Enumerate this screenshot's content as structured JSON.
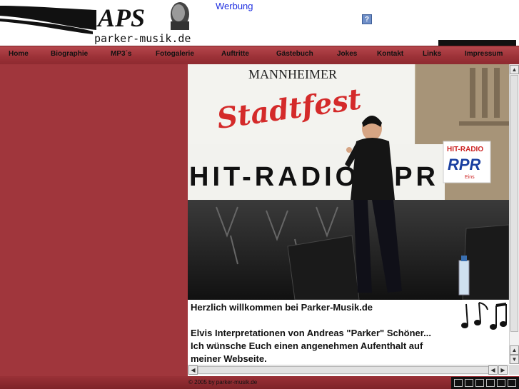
{
  "header": {
    "logo_text": "APS",
    "logo_domain": "parker-musik.de",
    "ad_link": "Werbung",
    "ad_icon": "?"
  },
  "nav": {
    "items": [
      {
        "label": "Home"
      },
      {
        "label": "Biographie"
      },
      {
        "label": "MP3´s"
      },
      {
        "label": "Fotogalerie"
      },
      {
        "label": "Auftritte"
      },
      {
        "label": "Gästebuch"
      },
      {
        "label": "Jokes"
      },
      {
        "label": "Kontakt"
      },
      {
        "label": "Links"
      },
      {
        "label": "Impressum"
      }
    ]
  },
  "photo": {
    "banner_top_line1": "MANNHEIMER",
    "banner_top_line2": "Stadtfest",
    "banner_radio": "HIT-RADIO RPR",
    "badge_line1": "HIT-RADIO",
    "badge_line2": "RPR",
    "badge_line3": "Eins"
  },
  "content": {
    "welcome": "Herzlich willkommen bei Parker-Musik.de",
    "line1": "Elvis Interpretationen von Andreas \"Parker\" Schöner...",
    "line2": "Ich wünsche Euch einen angenehmen Aufenthalt auf",
    "line3": "meiner Webseite."
  },
  "footer": {
    "copyright": "© 2005 by parker-musik.de"
  },
  "colors": {
    "nav_bar": "#9c3137",
    "left_column": "#a0363c",
    "link_blue": "#1f2fe0"
  }
}
